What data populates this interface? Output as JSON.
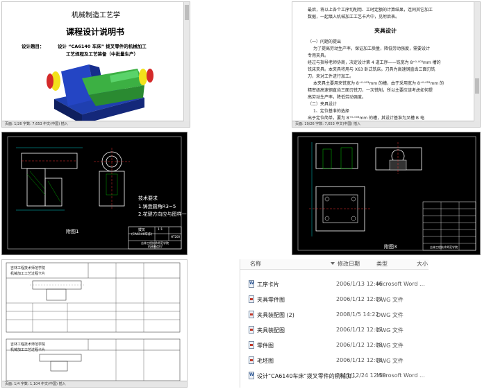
{
  "doc_cover": {
    "title": "机械制造工艺学",
    "subtitle": "课程设计说明书",
    "topic_label": "设计题目：",
    "topic_line1": "设计 “CA6140 车床” 拨叉零件的机械加工",
    "topic_line2": "工艺规程及工艺装备（中批量生产）",
    "status": "页面: 1/26   字数: 7,653   中文(中国)   插入"
  },
  "doc_fixture": {
    "top_lines": [
      "最后，将以上各个工序切削用、工时定额的计算结果，连同其它加工",
      "数据，一起填入机械加工工艺卡片中，见附后表。"
    ],
    "heading": "夹具设计",
    "sections": [
      "（一）问题的提出",
      "为了提高劳动生产率，保证加工质量，降低劳动强度，需要设计",
      "专用夹具。",
      "经过与指导老师协商，决定设计第 4 道工序——铣宽为 8⁺⁰·⁰⁰³mm 槽的",
      "铣床夹具。本夹具将用与 X63 卧式铣床。刀具为高速钢直齿三面刃铣",
      "刀，来对工件进行加工。",
      "本夹具主要用来铣宽为 8⁺⁰·⁰⁰³mm 的槽，由于采用宽为 8⁺⁰·⁰²²mm 的",
      "精密级高速钢直齿三面刃铣刀，一次铣削，所以主要应该考虑如何提",
      "高劳动生产率，降低劳动强度。",
      "（二）夹具设计",
      "1、定位基准的选择",
      "出于定位简单，要为 8⁺⁰·⁰⁰³mm 的槽，其设计基准为叉槽 B 电",
      "面。由于加工方面考虑，以 φ25 孔下部作为定位基准，由于此"
    ],
    "status": "页面: 19/26   字数: 7,653   中文(中国)   插入"
  },
  "cad_part": {
    "tech_title": "技术要求",
    "tech_lines": [
      "1.铸造圆角R3~5",
      "2.花键方向应与图样一致"
    ],
    "sheet_label": "附图1",
    "tb_part": "拨叉",
    "tb_machine": "(CA6140车床)",
    "tb_scale": "1:1",
    "tb_material": "HT200",
    "tb_school": "吉林工程技术师范学院",
    "tb_class": "机械制造07"
  },
  "cad_assembly": {
    "sheet_label": "附图3",
    "tb_school": "吉林工程技术师范学院"
  },
  "doc_process": {
    "header_left": "吉林工程技术师范学院",
    "header_left2": "机械加工工艺过程卡片",
    "status": "页面: 1/4   字数: 1,104   中文(中国)   插入"
  },
  "explorer": {
    "columns": {
      "name": "名称",
      "date": "修改日期",
      "type": "类型",
      "size": "大小"
    },
    "files": [
      {
        "name": "工序卡片",
        "date": "2006/1/13 12:46",
        "type": "Microsoft Word ...",
        "icon": "word-doc-icon"
      },
      {
        "name": "夹具零件图",
        "date": "2006/1/12 12:07",
        "type": "DWG 文件",
        "icon": "dwg-file-icon"
      },
      {
        "name": "夹具装配图 (2)",
        "date": "2008/1/5 14:22",
        "type": "DWG 文件",
        "icon": "dwg-file-icon"
      },
      {
        "name": "夹具装配图",
        "date": "2006/1/12 12:07",
        "type": "DWG 文件",
        "icon": "dwg-file-icon"
      },
      {
        "name": "零件图",
        "date": "2006/1/12 12:08",
        "type": "DWG 文件",
        "icon": "dwg-file-icon"
      },
      {
        "name": "毛坯图",
        "date": "2006/1/12 12:08",
        "type": "DWG 文件",
        "icon": "dwg-file-icon"
      },
      {
        "name": "设计“CA6140车床”拨叉零件的机械加...",
        "date": "2011/12/24 12:59",
        "type": "Microsoft Word ...",
        "icon": "word-doc-icon"
      }
    ]
  },
  "colors": {
    "cad_bg": "#000000",
    "part_green": "#3cb043",
    "part_blue": "#1f3fb0",
    "part_yellow": "#f2e21b",
    "part_red": "#d42a2a"
  }
}
